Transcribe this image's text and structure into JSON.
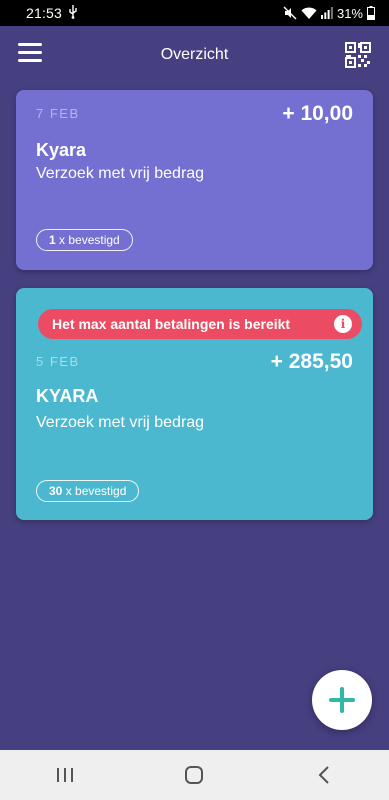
{
  "status_bar": {
    "time": "21:53",
    "battery": "31%",
    "icons": [
      "usb-icon",
      "mute-icon",
      "wifi-icon",
      "signal-icon",
      "battery-icon"
    ]
  },
  "header": {
    "title": "Overzicht",
    "menu_icon": "hamburger-icon",
    "qr_icon": "qr-code-icon"
  },
  "cards": [
    {
      "date": "7 FEB",
      "amount": "+ 10,00",
      "name": "Kyara",
      "description": "Verzoek met vrij bedrag",
      "confirmed_count": "1",
      "confirmed_label": "x bevestigd",
      "color": "#7470d2"
    },
    {
      "alert": "Het max aantal betalingen is bereikt",
      "alert_icon": "info-icon",
      "date": "5 FEB",
      "amount": "+ 285,50",
      "name": "KYARA",
      "description": "Verzoek met vrij bedrag",
      "confirmed_count": "30",
      "confirmed_label": "x bevestigd",
      "color": "#4cb8cf"
    }
  ],
  "fab": {
    "icon": "plus-icon",
    "color": "#2fb8a6"
  },
  "nav_bar": {
    "icons": [
      "recent-apps-icon",
      "home-icon",
      "back-icon"
    ]
  },
  "colors": {
    "background": "#463f80",
    "alert": "#eb4c64"
  }
}
